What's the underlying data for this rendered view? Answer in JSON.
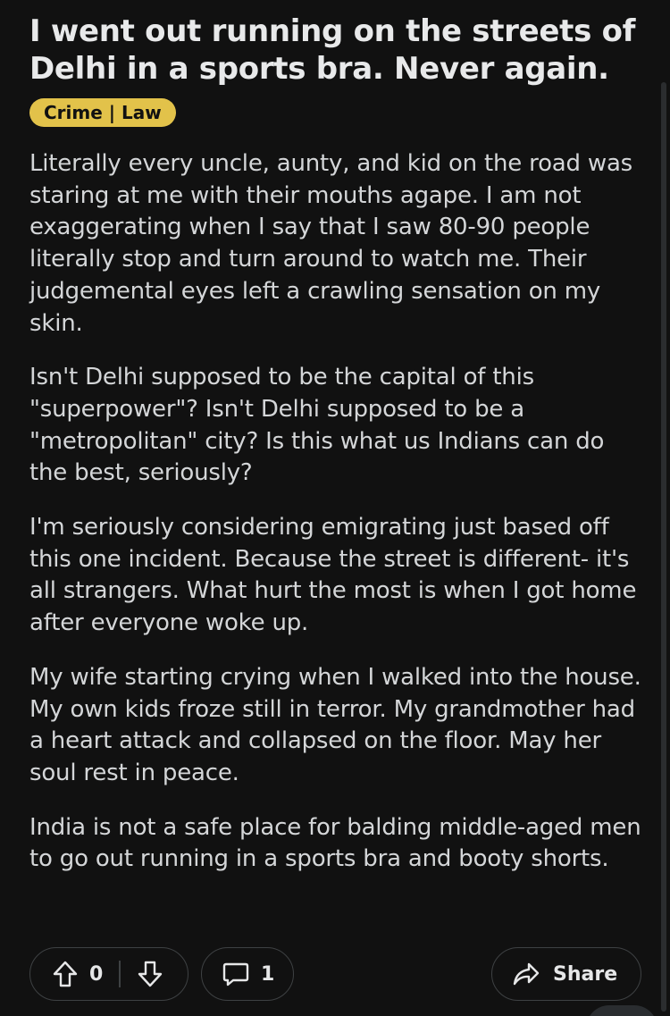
{
  "post": {
    "title": "I went out running on the streets of Delhi in a sports bra. Never again.",
    "flair": "Crime | Law",
    "flair_color": "#e2c24a",
    "paragraphs": [
      "Literally every uncle, aunty, and kid on the road was staring at me with their mouths agape. I am not exaggerating when I say that I saw 80-90 people literally stop and turn around to watch me. Their judgemental eyes left a crawling sensation on my skin.",
      "Isn't Delhi supposed to be the capital of this \"superpower\"? Isn't Delhi supposed to be a \"metropolitan\" city? Is this what us Indians can do the best, seriously?",
      "I'm seriously considering emigrating just based off this one incident. Because the street is different- it's all strangers. What hurt the most is when I got home after everyone woke up.",
      "My wife starting crying when I walked into the house. My own kids froze still in terror. My grandmother had a heart attack and collapsed on the floor. May her soul rest in peace.",
      "India is not a safe place for balding middle-aged men to go out running in a sports bra and booty shorts."
    ]
  },
  "actions": {
    "vote_count": "0",
    "comment_count": "1",
    "share_label": "Share",
    "icons": {
      "upvote": "arrow-up-icon",
      "downvote": "arrow-down-icon",
      "comment": "speech-bubble-icon",
      "share": "share-arrow-icon"
    }
  },
  "colors": {
    "background": "#111111",
    "text": "#d4d6d8",
    "pill_border": "#3e4143"
  }
}
